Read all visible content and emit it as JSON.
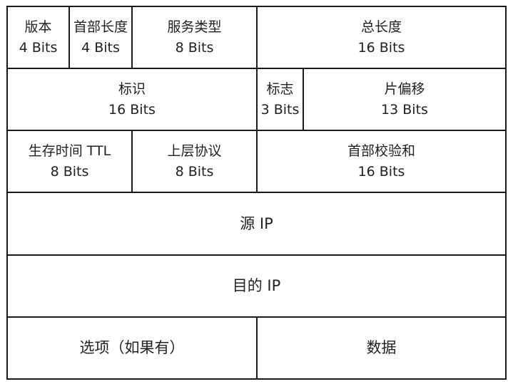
{
  "header": {
    "version": {
      "name": "版本",
      "bits": "4 Bits"
    },
    "ihl": {
      "name": "首部长度",
      "bits": "4 Bits"
    },
    "tos": {
      "name": "服务类型",
      "bits": "8 Bits"
    },
    "total_length": {
      "name": "总长度",
      "bits": "16 Bits"
    },
    "identification": {
      "name": "标识",
      "bits": "16 Bits"
    },
    "flags": {
      "name": "标志",
      "bits": "3 Bits"
    },
    "fragment_offset": {
      "name": "片偏移",
      "bits": "13 Bits"
    },
    "ttl": {
      "name": "生存时间 TTL",
      "bits": "8 Bits"
    },
    "protocol": {
      "name": "上层协议",
      "bits": "8 Bits"
    },
    "checksum": {
      "name": "首部校验和",
      "bits": "16 Bits"
    },
    "source_ip": {
      "name": "源 IP"
    },
    "dest_ip": {
      "name": "目的 IP"
    },
    "options": {
      "name": "选项（如果有）"
    },
    "data": {
      "name": "数据"
    }
  }
}
